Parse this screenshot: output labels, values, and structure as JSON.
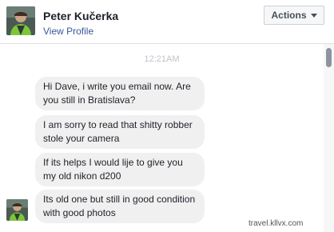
{
  "header": {
    "name": "Peter Kučerka",
    "view_profile": "View Profile",
    "actions_label": "Actions",
    "avatar_icon": "user-avatar-icon"
  },
  "thread": {
    "timestamp": "12:21AM",
    "messages": [
      "Hi Dave, i write you email now. Are you still in Bratislava?",
      "I am sorry to read that shitty robber stole your camera",
      "If its helps I would lije to give you my old nikon d200",
      "Its old one but still in good condition with good photos"
    ]
  },
  "watermark": "travel.kllvx.com",
  "colors": {
    "link": "#365899",
    "bubble": "#f1f0f0",
    "timestamp": "#bec3c9"
  }
}
